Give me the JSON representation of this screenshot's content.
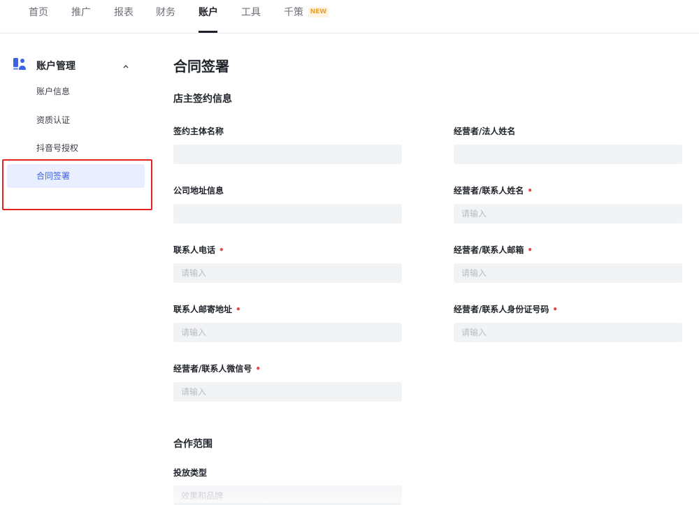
{
  "nav": {
    "items": [
      "首页",
      "推广",
      "报表",
      "财务",
      "账户",
      "工具",
      "千策"
    ],
    "active": "账户",
    "new_badge": "NEW"
  },
  "sidebar": {
    "group_title": "账户管理",
    "group_icon": "account-icon",
    "items": [
      "账户信息",
      "资质认证",
      "抖音号授权",
      "合同签署"
    ],
    "active_item": "合同签署"
  },
  "main": {
    "page_title": "合同签署",
    "sections": {
      "owner_info": "店主签约信息",
      "cooperation": "合作范围"
    },
    "fields": {
      "entity_name": {
        "label": "签约主体名称",
        "value": "",
        "placeholder": ""
      },
      "legal_name": {
        "label": "经营者/法人姓名",
        "value": "",
        "placeholder": ""
      },
      "company_address": {
        "label": "公司地址信息",
        "value": "",
        "placeholder": ""
      },
      "contact_name": {
        "label": "经营者/联系人姓名",
        "placeholder": "请输入",
        "required": "•"
      },
      "contact_phone": {
        "label": "联系人电话",
        "placeholder": "请输入",
        "required": "•"
      },
      "contact_email": {
        "label": "经营者/联系人邮箱",
        "placeholder": "请输入",
        "required": "•"
      },
      "mail_address": {
        "label": "联系人邮寄地址",
        "placeholder": "请输入",
        "required": "•"
      },
      "contact_id": {
        "label": "经营者/联系人身份证号码",
        "placeholder": "请输入",
        "required": "•"
      },
      "wechat": {
        "label": "经营者/联系人微信号",
        "placeholder": "请输入",
        "required": "•"
      },
      "launch_type": {
        "label": "投放类型",
        "value": "效果和品牌"
      }
    }
  },
  "colors": {
    "accent": "#3c63e6",
    "active_bg": "#e9efff",
    "highlight_border": "#e52222",
    "required": "#e5484d",
    "input_bg": "#f2f3f5"
  }
}
